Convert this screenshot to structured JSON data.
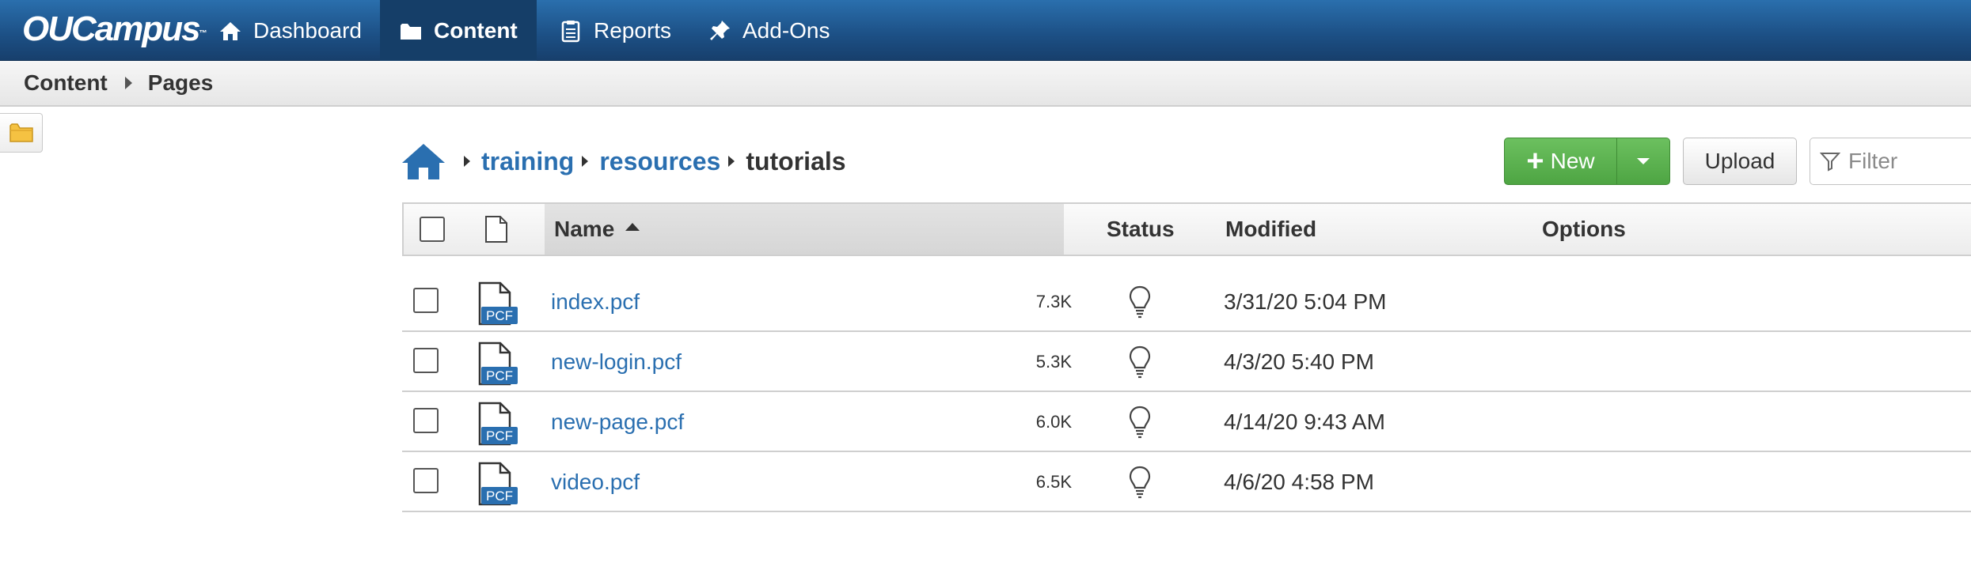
{
  "app": {
    "logo_text": "OUCampus",
    "logo_mark": "™"
  },
  "nav": {
    "items": [
      {
        "label": "Dashboard",
        "icon": "home-icon",
        "active": false
      },
      {
        "label": "Content",
        "icon": "folder-icon",
        "active": true
      },
      {
        "label": "Reports",
        "icon": "clipboard-icon",
        "active": false
      },
      {
        "label": "Add-Ons",
        "icon": "pin-icon",
        "active": false
      }
    ]
  },
  "breadcrumb": {
    "items": [
      "Content",
      "Pages"
    ]
  },
  "path": {
    "home_icon": "home-icon",
    "segments": [
      "training",
      "resources"
    ],
    "current": "tutorials"
  },
  "toolbar": {
    "new_label": "New",
    "upload_label": "Upload",
    "filter_placeholder": "Filter"
  },
  "table": {
    "columns": {
      "name": "Name",
      "status": "Status",
      "modified": "Modified",
      "options": "Options"
    },
    "file_badge": "PCF",
    "rows": [
      {
        "name": "index.pcf",
        "size": "7.3K",
        "modified": "3/31/20 5:04 PM"
      },
      {
        "name": "new-login.pcf",
        "size": "5.3K",
        "modified": "4/3/20 5:40 PM"
      },
      {
        "name": "new-page.pcf",
        "size": "6.0K",
        "modified": "4/14/20 9:43 AM"
      },
      {
        "name": "video.pcf",
        "size": "6.5K",
        "modified": "4/6/20 4:58 PM"
      }
    ]
  },
  "colors": {
    "nav_bg": "#1c4f84",
    "link": "#2a6fb0",
    "new_button": "#5cb452",
    "pcf_badge": "#2a6fb0"
  }
}
